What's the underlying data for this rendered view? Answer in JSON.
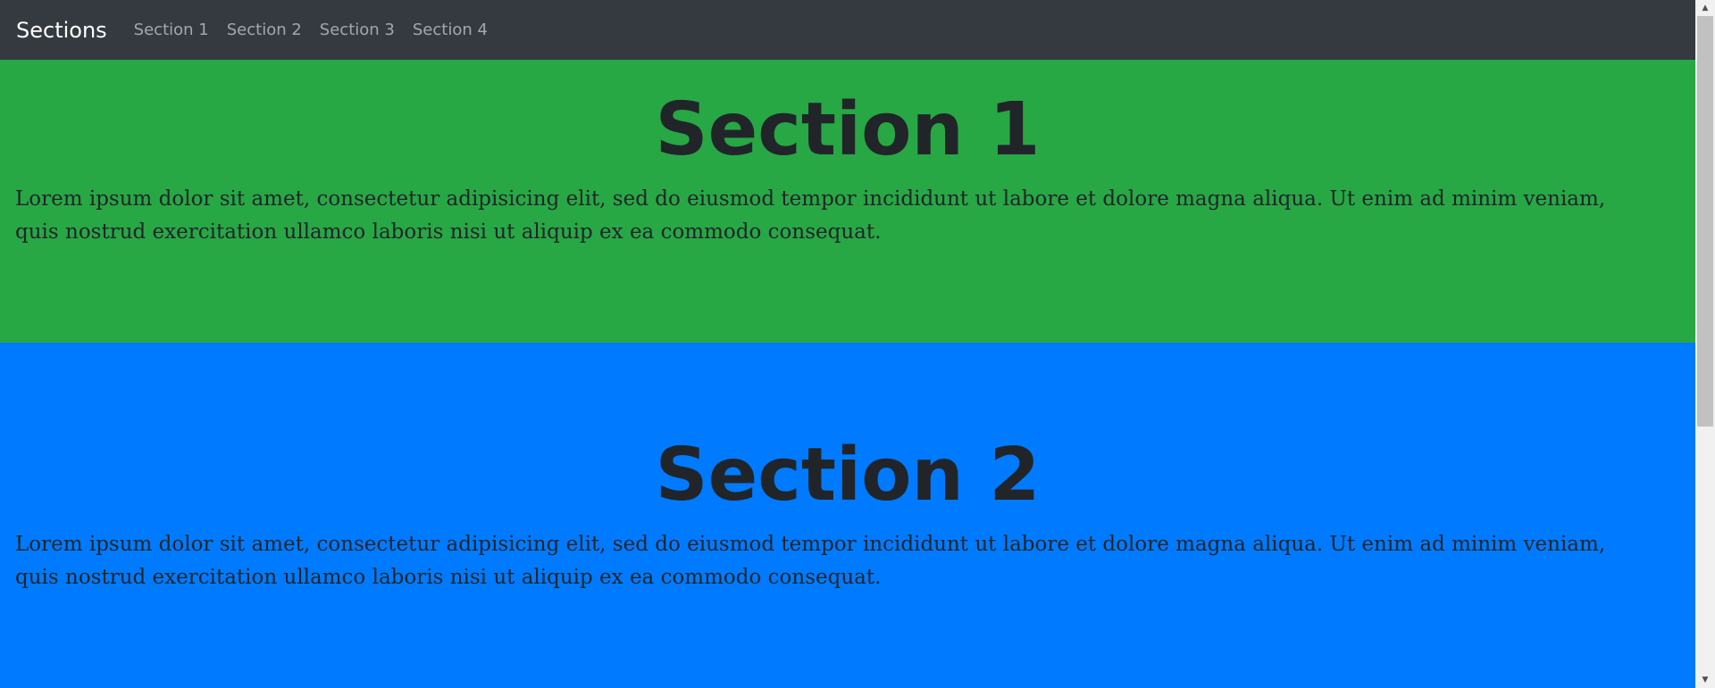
{
  "navbar": {
    "brand": "Sections",
    "links": [
      {
        "label": "Section 1"
      },
      {
        "label": "Section 2"
      },
      {
        "label": "Section 3"
      },
      {
        "label": "Section 4"
      }
    ],
    "background": "#343a40"
  },
  "sections": [
    {
      "title": "Section 1",
      "text": "Lorem ipsum dolor sit amet, consectetur adipisicing elit, sed do eiusmod tempor incididunt ut labore et dolore magna aliqua. Ut enim ad minim veniam, quis nostrud exercitation ullamco laboris nisi ut aliquip ex ea commodo consequat.",
      "background": "#28a745"
    },
    {
      "title": "Section 2",
      "text": "Lorem ipsum dolor sit amet, consectetur adipisicing elit, sed do eiusmod tempor incididunt ut labore et dolore magna aliqua. Ut enim ad minim veniam, quis nostrud exercitation ullamco laboris nisi ut aliquip ex ea commodo consequat.",
      "background": "#007bff"
    }
  ],
  "scrollbar": {
    "up_icon": "▲",
    "down_icon": "▼",
    "thumb_color": "#c1c1c1"
  }
}
